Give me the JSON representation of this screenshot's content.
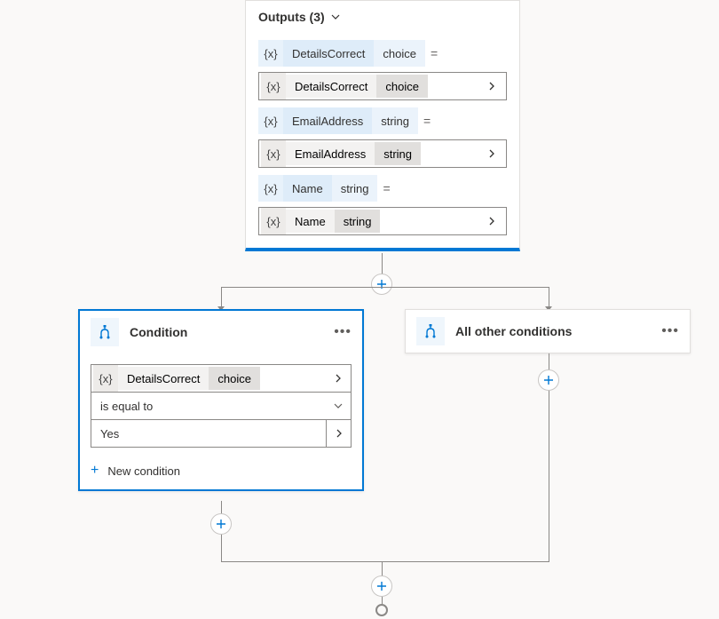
{
  "outputs": {
    "title": "Outputs (3)",
    "items": [
      {
        "name": "DetailsCorrect",
        "type": "choice"
      },
      {
        "name": "EmailAddress",
        "type": "string"
      },
      {
        "name": "Name",
        "type": "string"
      }
    ]
  },
  "condition": {
    "title": "Condition",
    "variable": {
      "name": "DetailsCorrect",
      "type": "choice"
    },
    "operator": "is equal to",
    "value": "Yes",
    "newConditionLabel": "New condition"
  },
  "otherCondition": {
    "title": "All other conditions"
  },
  "glyphs": {
    "varToken": "{x}",
    "equals": "="
  }
}
